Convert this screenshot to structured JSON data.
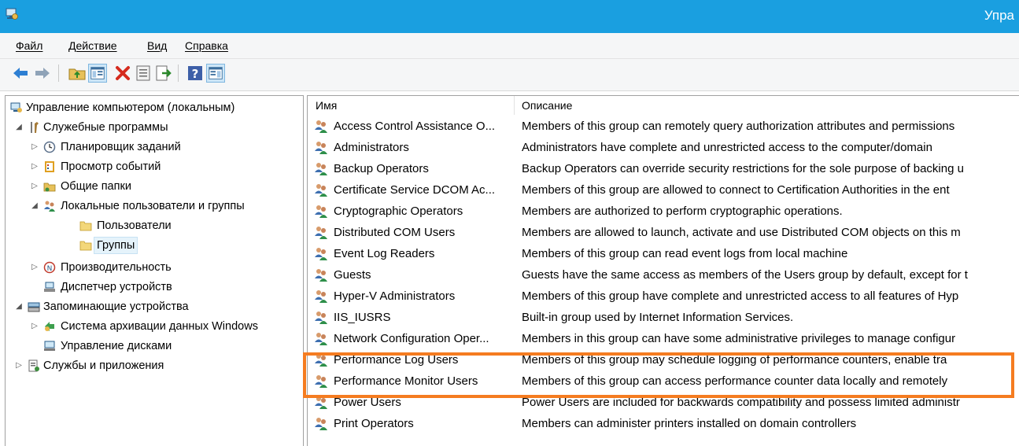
{
  "window": {
    "title": "Упра",
    "app_icon": "computer-management-icon",
    "title_bar_color": "#1a9fe0"
  },
  "menu": {
    "items": [
      "Файл",
      "Действие",
      "Вид",
      "Справка"
    ]
  },
  "toolbar": {
    "buttons": [
      "back-arrow-icon",
      "forward-arrow-icon",
      "up-folder-icon",
      "show-hide-tree-icon",
      "delete-icon",
      "properties-icon",
      "export-list-icon",
      "help-icon",
      "action-pane-icon"
    ]
  },
  "tree": {
    "root": "Управление компьютером (локальным)",
    "system_tools": "Служебные программы",
    "task_scheduler": "Планировщик заданий",
    "event_viewer": "Просмотр событий",
    "shared_folders": "Общие папки",
    "local_users_groups": "Локальные пользователи и группы",
    "users": "Пользователи",
    "groups": "Группы",
    "performance": "Производительность",
    "device_manager": "Диспетчер устройств",
    "storage": "Запоминающие устройства",
    "backup": "Система архивации данных Windows",
    "disk_management": "Управление дисками",
    "services_apps": "Службы и приложения"
  },
  "list": {
    "columns": {
      "name": "Имя",
      "description": "Описание"
    },
    "rows": [
      {
        "name": "Access Control Assistance O...",
        "description": "Members of this group can remotely query authorization attributes and permissions"
      },
      {
        "name": "Administrators",
        "description": "Administrators have complete and unrestricted access to the computer/domain"
      },
      {
        "name": "Backup Operators",
        "description": "Backup Operators can override security restrictions for the sole purpose of backing u"
      },
      {
        "name": "Certificate Service DCOM Ac...",
        "description": "Members of this group are allowed to connect to Certification Authorities in the ent"
      },
      {
        "name": "Cryptographic Operators",
        "description": "Members are authorized to perform cryptographic operations."
      },
      {
        "name": "Distributed COM Users",
        "description": "Members are allowed to launch, activate and use Distributed COM objects on this m"
      },
      {
        "name": "Event Log Readers",
        "description": "Members of this group can read event logs from local machine"
      },
      {
        "name": "Guests",
        "description": "Guests have the same access as members of the Users group by default, except for t"
      },
      {
        "name": "Hyper-V Administrators",
        "description": "Members of this group have complete and unrestricted access to all features of Hyp"
      },
      {
        "name": "IIS_IUSRS",
        "description": "Built-in group used by Internet Information Services."
      },
      {
        "name": "Network Configuration Oper...",
        "description": "Members in this group can have some administrative privileges to manage configur"
      },
      {
        "name": "Performance Log Users",
        "description": "Members of this group may schedule logging of performance counters, enable tra"
      },
      {
        "name": "Performance Monitor Users",
        "description": "Members of this group can access performance counter data locally and remotely"
      },
      {
        "name": "Power Users",
        "description": "Power Users are included for backwards compatibility and possess limited administr"
      },
      {
        "name": "Print Operators",
        "description": "Members can administer printers installed on domain controllers"
      }
    ]
  },
  "highlight_color": "#f57c20"
}
